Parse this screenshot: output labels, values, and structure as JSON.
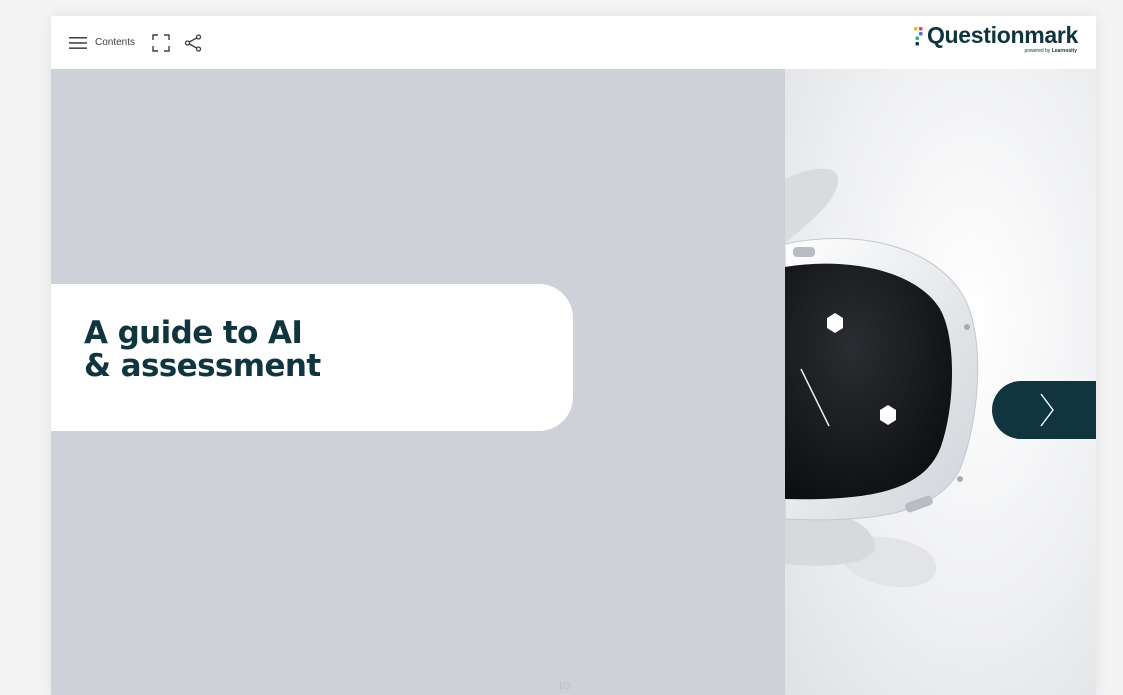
{
  "toolbar": {
    "menu_icon": "hamburger-icon",
    "contents_label": "Contents",
    "fullscreen_icon": "fullscreen-icon",
    "share_icon": "share-icon"
  },
  "logo": {
    "name": "Questionmark",
    "tagline_prefix": "powered by",
    "tagline_brand": "Learnosity",
    "mark_colors": [
      "#f3b61f",
      "#e4405f",
      "#4a6ee0",
      "#2bb673"
    ]
  },
  "slide": {
    "title_line1": "A guide to AI",
    "title_line2": "& assessment",
    "next_icon": "chevron-right-icon",
    "page_indicator": "1/3"
  },
  "colors": {
    "brand_dark": "#10353f",
    "slide_bg": "#ced2d8"
  }
}
